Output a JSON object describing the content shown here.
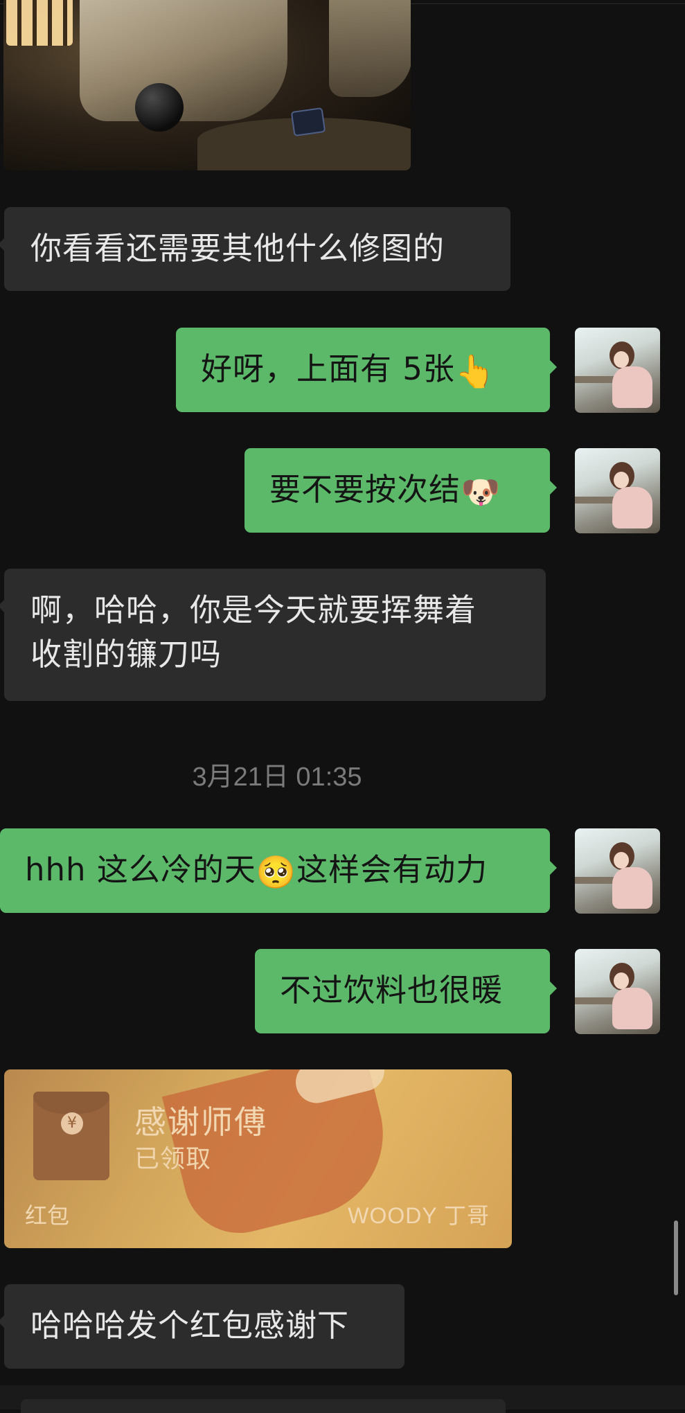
{
  "messages": [
    {
      "id": "m1",
      "direction": "in",
      "text": "你看看还需要其他什么修图的"
    },
    {
      "id": "m2",
      "direction": "out",
      "text": "好呀，上面有 5张",
      "emoji": "👆"
    },
    {
      "id": "m3",
      "direction": "out",
      "text": "要不要按次结",
      "emoji": "🐶"
    },
    {
      "id": "m4",
      "direction": "in",
      "lines": [
        "啊，哈哈，你是今天就要挥舞着",
        "收割的镰刀吗"
      ]
    },
    {
      "id": "m5",
      "direction": "out",
      "text_before": "hhh 这么冷的天",
      "emoji": "🥺",
      "text_after": "这样会有动力"
    },
    {
      "id": "m6",
      "direction": "out",
      "text": "不过饮料也很暖"
    },
    {
      "id": "m7",
      "direction": "in",
      "text": "哈哈哈发个红包感谢下"
    }
  ],
  "timestamp": "3月21日 01:35",
  "red_packet": {
    "title": "感谢师傅",
    "status": "已领取",
    "label": "红包",
    "sender": "WOODY 丁哥",
    "coin_symbol": "¥"
  },
  "colors": {
    "background": "#111111",
    "incoming_bubble": "#2c2c2c",
    "outgoing_bubble": "#5cb96a",
    "timestamp": "#7b7b7b"
  }
}
